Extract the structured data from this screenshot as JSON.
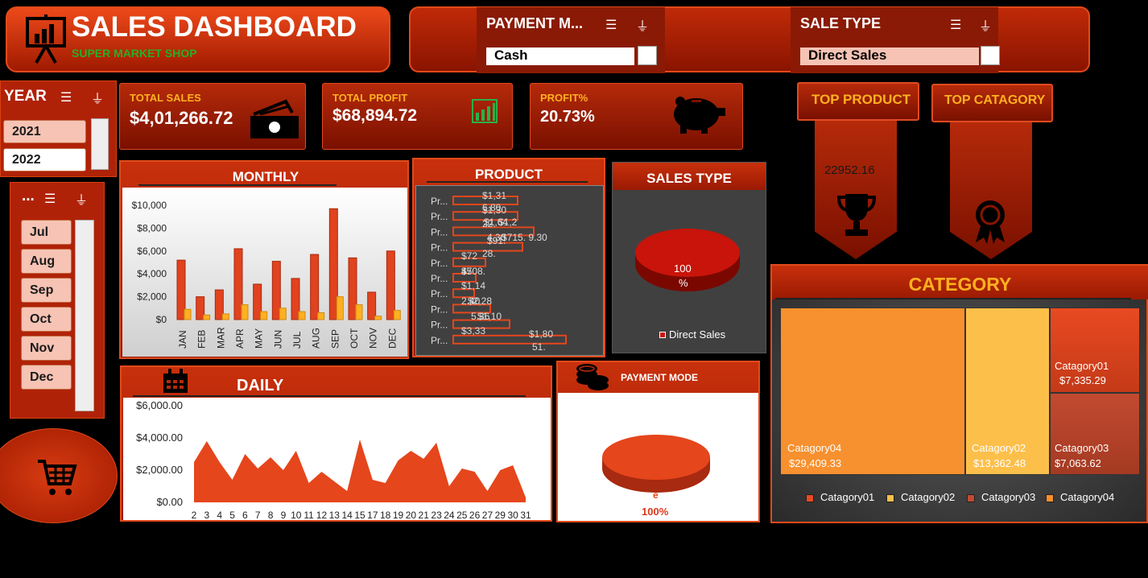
{
  "header": {
    "title": "SALES DASHBOARD",
    "subtitle": "SUPER MARKET SHOP"
  },
  "filters": {
    "payment": {
      "title": "PAYMENT M...",
      "value": "Cash"
    },
    "sale_type": {
      "title": "SALE TYPE",
      "value": "Direct Sales"
    }
  },
  "year_slicer": {
    "title": "YEAR",
    "items": [
      "2021",
      "2022"
    ]
  },
  "month_slicer": {
    "title": "...",
    "items": [
      "Jul",
      "Aug",
      "Sep",
      "Oct",
      "Nov",
      "Dec"
    ]
  },
  "kpis": {
    "total_sales": {
      "label": "TOTAL SALES",
      "value": "$4,01,266.72"
    },
    "total_profit": {
      "label": "TOTAL PROFIT",
      "value": "$68,894.72"
    },
    "profit_pct": {
      "label": "PROFIT%",
      "value": "20.73%"
    }
  },
  "top": {
    "product_label": "TOP PRODUCT",
    "product_value": "22952.16",
    "category_label": "TOP CATAGORY"
  },
  "monthly": {
    "title": "MONTHLY",
    "chart_data": {
      "type": "bar",
      "categories": [
        "JAN",
        "FEB",
        "MAR",
        "APR",
        "MAY",
        "JUN",
        "JUL",
        "AUG",
        "SEP",
        "OCT",
        "NOV",
        "DEC"
      ],
      "series": [
        {
          "values": [
            5200,
            2000,
            2600,
            6200,
            3100,
            5100,
            3600,
            5700,
            9700,
            5400,
            2400,
            6000
          ]
        },
        {
          "values": [
            900,
            400,
            500,
            1300,
            700,
            1000,
            700,
            600,
            2000,
            1300,
            300,
            800
          ]
        }
      ],
      "yticks": [
        "$10,000",
        "$8,000",
        "$6,000",
        "$4,000",
        "$2,000",
        "$0"
      ],
      "ylim": [
        0,
        10000
      ]
    }
  },
  "product": {
    "title": "PRODUCT",
    "rows": [
      "Pr...",
      "Pr...",
      "Pr...",
      "Pr...",
      "Pr...",
      "Pr...",
      "Pr...",
      "Pr...",
      "Pr...",
      "Pr..."
    ],
    "labels": [
      "$1,31",
      "$1,30",
      "6.80",
      "$1,64",
      "$1,2",
      "4.30",
      "$715. 9.30",
      "$91.",
      "$72",
      "$708.",
      "45",
      "$1,14",
      "2.40",
      "$2,28",
      "5.36",
      "$3,33",
      "$1,10",
      "$1,80",
      "51.",
      "22.",
      "28."
    ]
  },
  "sales_type": {
    "title": "SALES TYPE",
    "pct": "100",
    "pct_sym": "%",
    "legend": "Direct Sales"
  },
  "daily": {
    "title": "DAILY",
    "yticks": [
      "$6,000.00",
      "$4,000.00",
      "$2,000.00",
      "$0.00"
    ],
    "xlabels": [
      "2",
      "3",
      "4",
      "5",
      "6",
      "7",
      "8",
      "9",
      "10",
      "11",
      "12",
      "13",
      "14",
      "15",
      "17",
      "18",
      "19",
      "20",
      "21",
      "23",
      "24",
      "25",
      "26",
      "27",
      "29",
      "30",
      "31"
    ],
    "chart_data": {
      "type": "area",
      "x": [
        "2",
        "3",
        "4",
        "5",
        "6",
        "7",
        "8",
        "9",
        "10",
        "11",
        "12",
        "13",
        "14",
        "15",
        "17",
        "18",
        "19",
        "20",
        "21",
        "23",
        "24",
        "25",
        "26",
        "27",
        "29",
        "30",
        "31"
      ],
      "values": [
        2500,
        3800,
        2500,
        1400,
        3000,
        2100,
        2800,
        2000,
        3200,
        1200,
        1900,
        1300,
        700,
        3900,
        1400,
        1200,
        2600,
        3200,
        2700,
        3700,
        1000,
        2100,
        1900,
        700,
        2000,
        2300,
        300
      ],
      "ylim": [
        0,
        6000
      ]
    }
  },
  "payment_mode": {
    "title": "PAYMENT MODE",
    "pct": "100%",
    "pie_label": "e"
  },
  "category": {
    "title": "CATEGORY",
    "chart_data": {
      "type": "treemap",
      "items": [
        {
          "name": "Catagory04",
          "value": "$29,409.33",
          "color": "#f7902e"
        },
        {
          "name": "Catagory02",
          "value": "$13,362.48",
          "color": "#fcbf4a"
        },
        {
          "name": "Catagory01",
          "value": "$7,335.29",
          "color": "#e64a22"
        },
        {
          "name": "Catagory03",
          "value": "$7,063.62",
          "color": "#c24a30"
        }
      ]
    },
    "legend": [
      "Catagory01",
      "Catagory02",
      "Catagory03",
      "Catagory04"
    ]
  },
  "colors": {
    "bar1": "#e0431e",
    "bar2": "#ffb020",
    "area": "#e5461c",
    "accent": "#ffb020"
  }
}
